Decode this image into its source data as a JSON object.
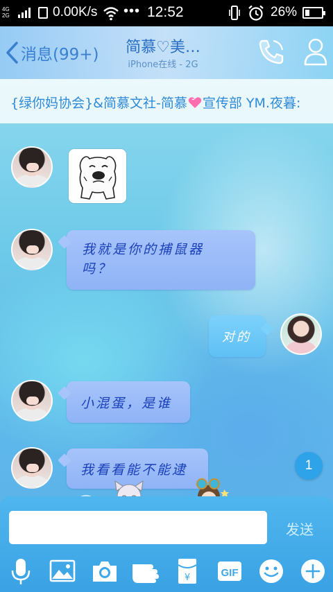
{
  "status_bar": {
    "signal_top": "4G",
    "signal_bottom": "2G",
    "net_speed": "0.00K/s",
    "dots": "•••",
    "time": "12:52",
    "battery_percent": "26%",
    "battery_level": 0.26
  },
  "header": {
    "back_label": "消息(99+)",
    "title": "简慕♡美…",
    "subtitle": "iPhone在线 - 2G"
  },
  "group_banner": {
    "text_before": "{绿你妈协会}&简慕文社-简慕",
    "text_after": "宣传部   YM.夜暮:"
  },
  "messages": [
    {
      "from": "other",
      "type": "sticker"
    },
    {
      "from": "other",
      "type": "text",
      "line1": "我就是你的捕鼠器",
      "line2": "吗？"
    },
    {
      "from": "me",
      "type": "text",
      "text": "对的"
    },
    {
      "from": "other",
      "type": "text",
      "text": "小混蛋，是谁"
    },
    {
      "from": "other",
      "type": "text",
      "text": "我看看能不能逮"
    }
  ],
  "unread_badge": "1",
  "input": {
    "value": "",
    "send_label": "发送"
  },
  "toolbar": [
    {
      "icon": "mic-icon"
    },
    {
      "icon": "image-icon"
    },
    {
      "icon": "camera-icon"
    },
    {
      "icon": "poke-hand-icon"
    },
    {
      "icon": "red-packet-icon",
      "symbol": "¥"
    },
    {
      "icon": "gif-icon",
      "label": "GIF"
    },
    {
      "icon": "emoji-icon"
    },
    {
      "icon": "plus-icon"
    }
  ],
  "colors": {
    "header_text": "#2a6fc4",
    "banner_text": "#2f8ad8",
    "incoming_bubble": "#a7c4fb",
    "outgoing_bubble": "#7cd1fb",
    "input_panel": "#3aa2e4"
  }
}
